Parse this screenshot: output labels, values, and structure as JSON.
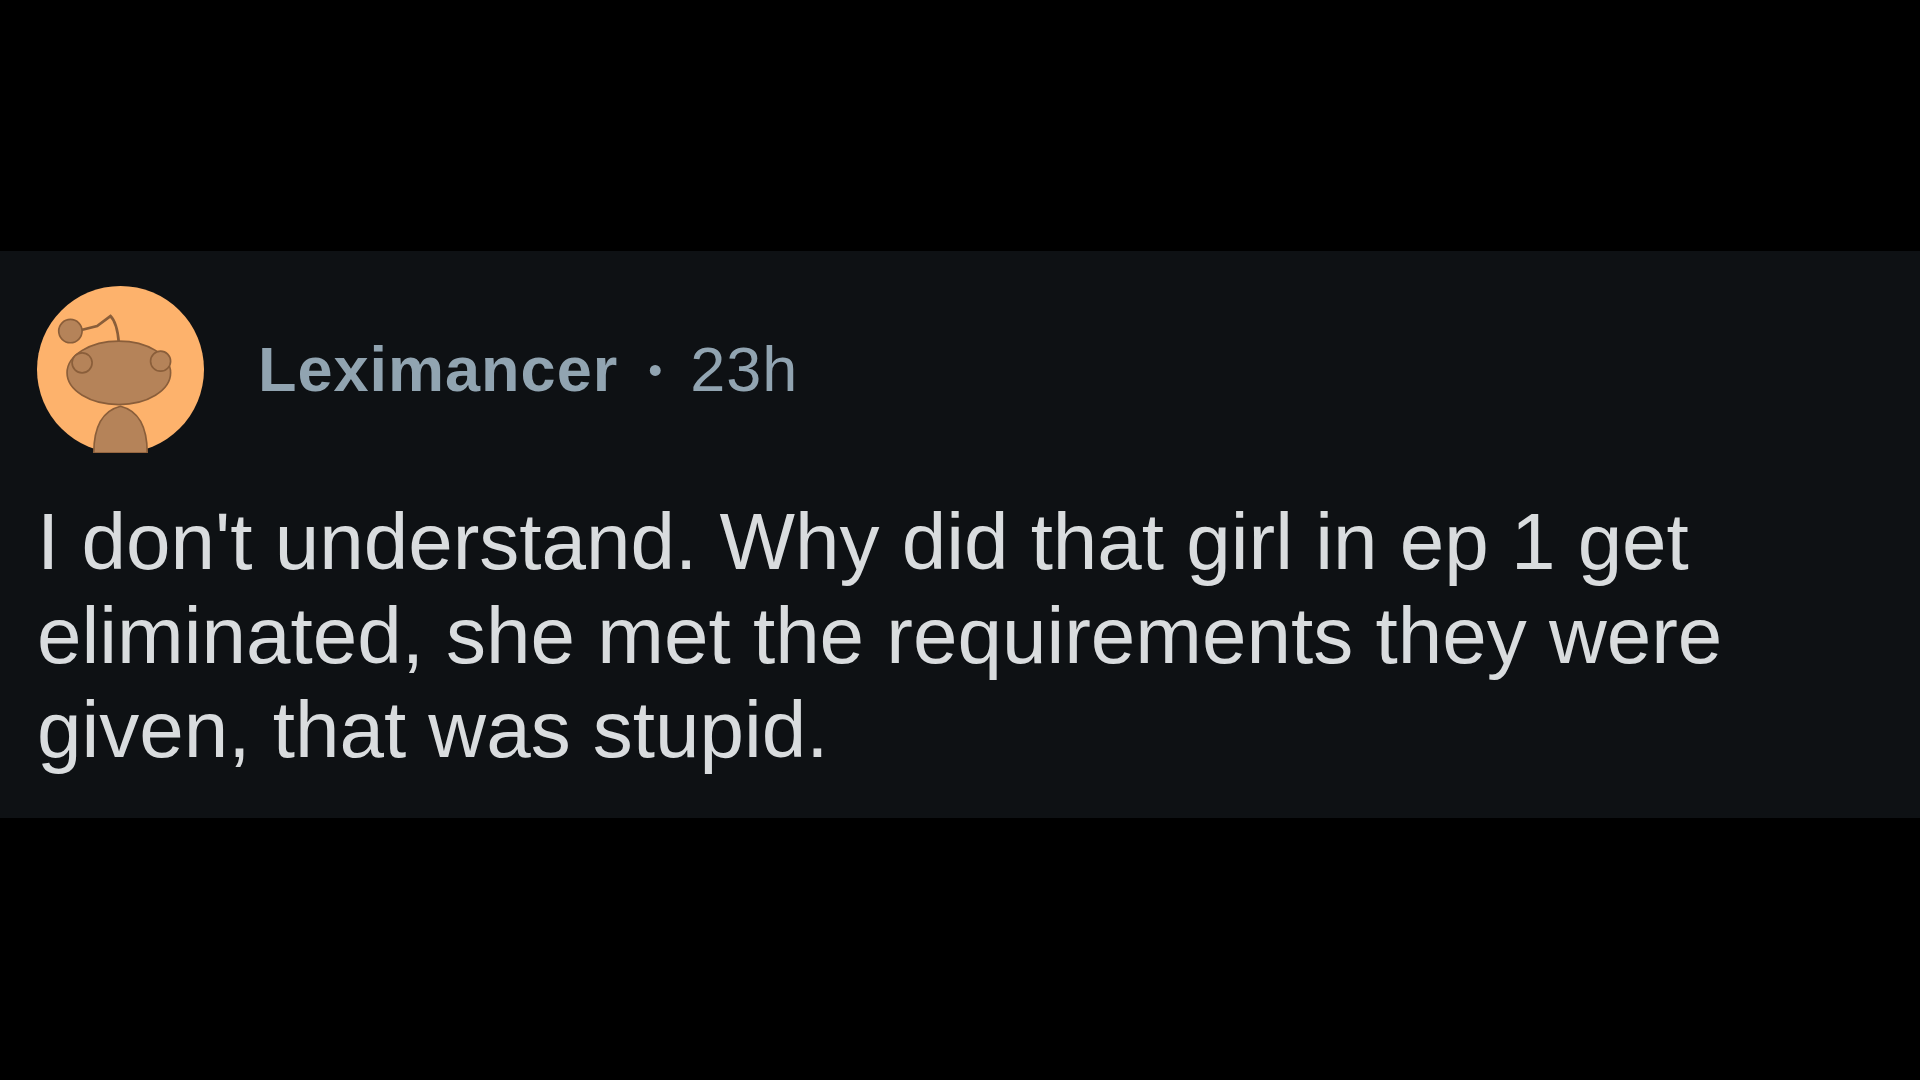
{
  "comment": {
    "author": "Leximancer",
    "separator": "•",
    "age": "23h",
    "body": "I don't understand. Why did that girl in ep 1 get eliminated, she met the requirements they were given, that was stupid."
  }
}
